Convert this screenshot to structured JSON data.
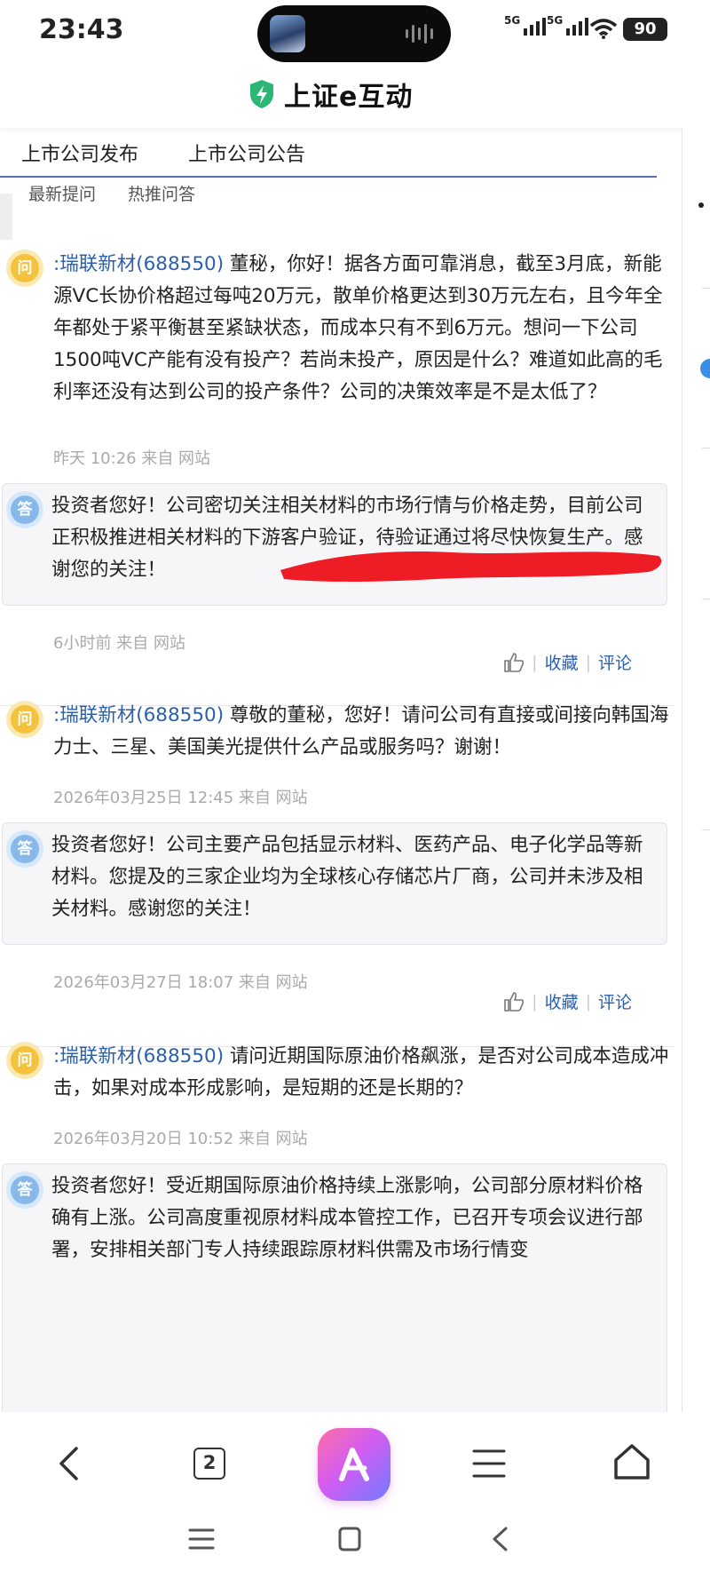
{
  "status_bar": {
    "time": "23:43",
    "signal1_label": "5G",
    "signal2_label": "5G",
    "battery": "90"
  },
  "app": {
    "title": "上证e互动",
    "brand_color": "#2bb673"
  },
  "tabs": [
    {
      "label": "上市公司发布"
    },
    {
      "label": "上市公司公告"
    }
  ],
  "subtabs": [
    {
      "label": "最新提问"
    },
    {
      "label": "热推问答"
    }
  ],
  "qa": [
    {
      "question_icon": "问",
      "company": ":瑞联新材(688550)",
      "question": " 董秘，你好！据各方面可靠消息，截至3月底，新能源VC长协价格超过每吨20万元，散单价格更达到30万元左右，且今年全年都处于紧平衡甚至紧缺状态，而成本只有不到6万元。想问一下公司1500吨VC产能有没有投产？若尚未投产，原因是什么？难道如此高的毛利率还没有达到公司的投产条件？公司的决策效率是不是太低了？",
      "question_meta": "昨天 10:26 来自 网站",
      "answer_icon": "答",
      "answer": "投资者您好！公司密切关注相关材料的市场行情与价格走势，目前公司正积极推进相关材料的下游客户验证，待验证通过将尽快恢复生产。感谢您的关注！",
      "answer_meta": "6小时前 来自 网站",
      "action_collect": "收藏",
      "action_comment": "评论"
    },
    {
      "question_icon": "问",
      "company": ":瑞联新材(688550)",
      "question": " 尊敬的董秘，您好！请问公司有直接或间接向韩国海力士、三星、美国美光提供什么产品或服务吗？谢谢！",
      "question_meta": "2026年03月25日 12:45 来自 网站",
      "answer_icon": "答",
      "answer": "投资者您好！公司主要产品包括显示材料、医药产品、电子化学品等新材料。您提及的三家企业均为全球核心存储芯片厂商，公司并未涉及相关材料。感谢您的关注！",
      "answer_meta": "2026年03月27日 18:07 来自 网站",
      "action_collect": "收藏",
      "action_comment": "评论"
    },
    {
      "question_icon": "问",
      "company": ":瑞联新材(688550)",
      "question": " 请问近期国际原油价格飙涨，是否对公司成本造成冲击，如果对成本形成影响，是短期的还是长期的？",
      "question_meta": "2026年03月20日 10:52 来自 网站",
      "answer_icon": "答",
      "answer": "投资者您好！受近期国际原油价格持续上涨影响，公司部分原材料价格确有上涨。公司高度重视原材料成本管控工作，已召开专项会议进行部署，安排相关部门专人持续跟踪原材料供需及市场行情变"
    }
  ],
  "bottom_nav": {
    "tab_count": "2"
  }
}
